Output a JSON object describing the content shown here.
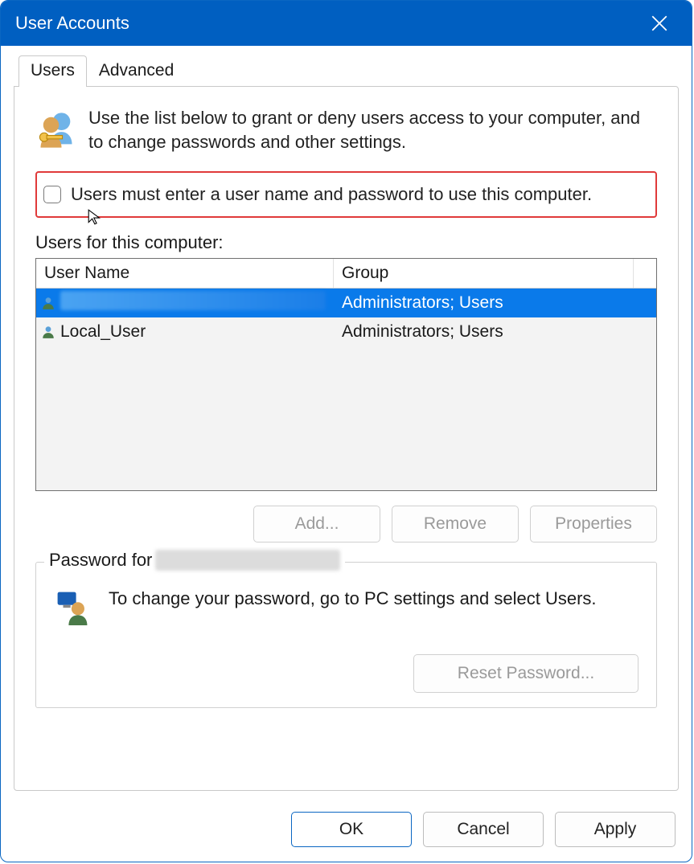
{
  "titlebar": {
    "title": "User Accounts"
  },
  "tabs": {
    "users": "Users",
    "advanced": "Advanced"
  },
  "intro": {
    "text": "Use the list below to grant or deny users access to your computer, and to change passwords and other settings."
  },
  "checkbox": {
    "label": "Users must enter a user name and password to use this computer.",
    "checked": false
  },
  "users_section": {
    "label": "Users for this computer:",
    "columns": {
      "name": "User Name",
      "group": "Group"
    },
    "rows": [
      {
        "name": "",
        "group": "Administrators; Users",
        "selected": true
      },
      {
        "name": "Local_User",
        "group": "Administrators; Users",
        "selected": false
      }
    ]
  },
  "user_buttons": {
    "add": "Add...",
    "remove": "Remove",
    "properties": "Properties"
  },
  "password_box": {
    "legend": "Password for",
    "text": "To change your password, go to PC settings and select Users.",
    "reset": "Reset Password..."
  },
  "footer": {
    "ok": "OK",
    "cancel": "Cancel",
    "apply": "Apply"
  }
}
